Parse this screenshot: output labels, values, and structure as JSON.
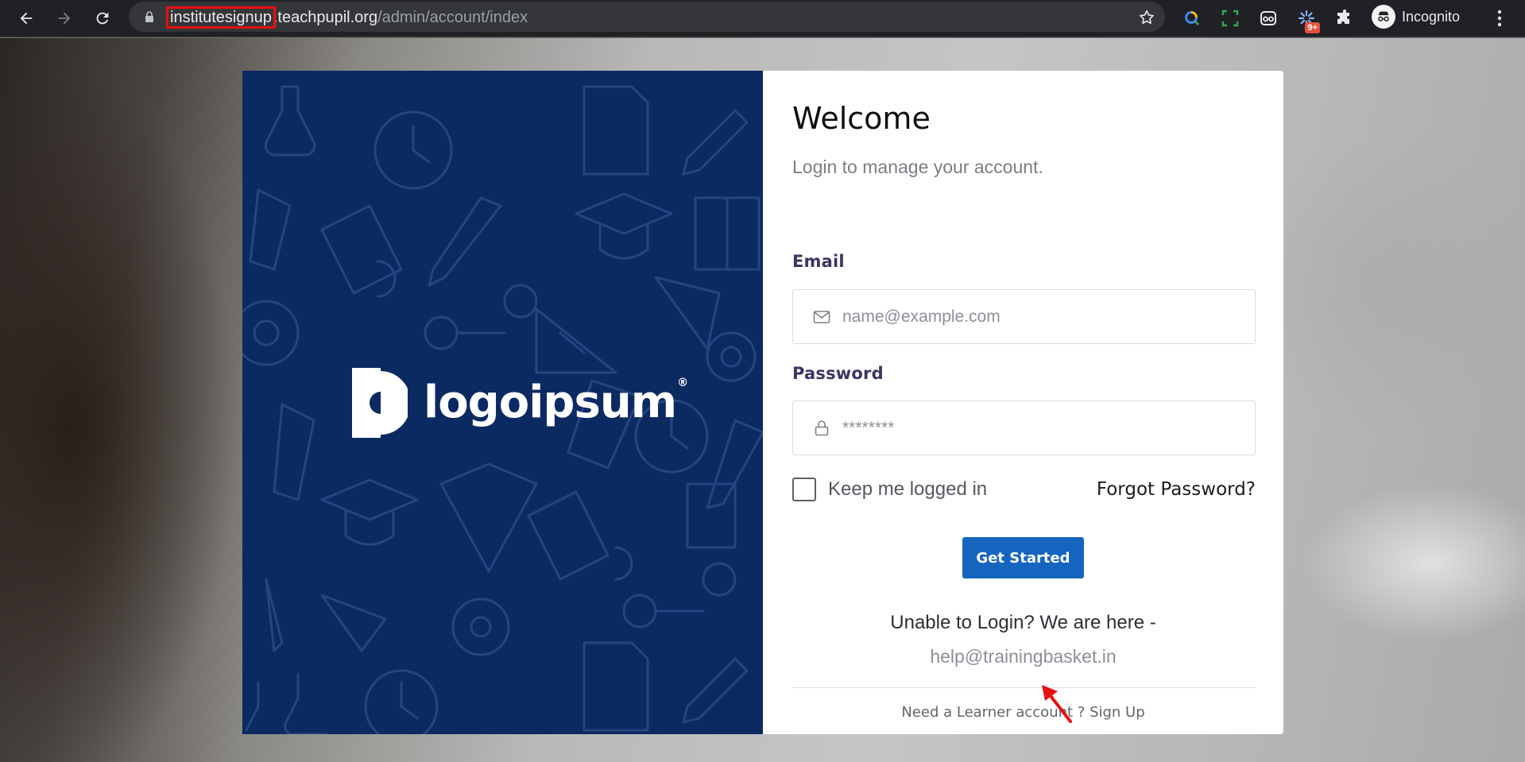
{
  "browser": {
    "url_host_highlight": "institutesignup",
    "url_host_rest": ".teachpupil.org",
    "url_path": "/admin/account/index",
    "profile_label": "Incognito",
    "extension_badge": "9+"
  },
  "brand": {
    "logo_text": "logoipsum",
    "logo_mark": "®"
  },
  "login": {
    "title": "Welcome",
    "subtitle": "Login to manage your account.",
    "email_label": "Email",
    "email_placeholder": "name@example.com",
    "password_label": "Password",
    "password_placeholder": "********",
    "remember_label": "Keep me logged in",
    "forgot_label": "Forgot Password?",
    "submit_label": "Get Started",
    "help_text": "Unable to Login? We are here -",
    "help_email": "help@trainingbasket.in",
    "signup_text": "Need a Learner account ? Sign Up"
  },
  "colors": {
    "brand_panel": "#0c2a62",
    "primary_button": "#1565c0",
    "annotation": "#e81010"
  }
}
